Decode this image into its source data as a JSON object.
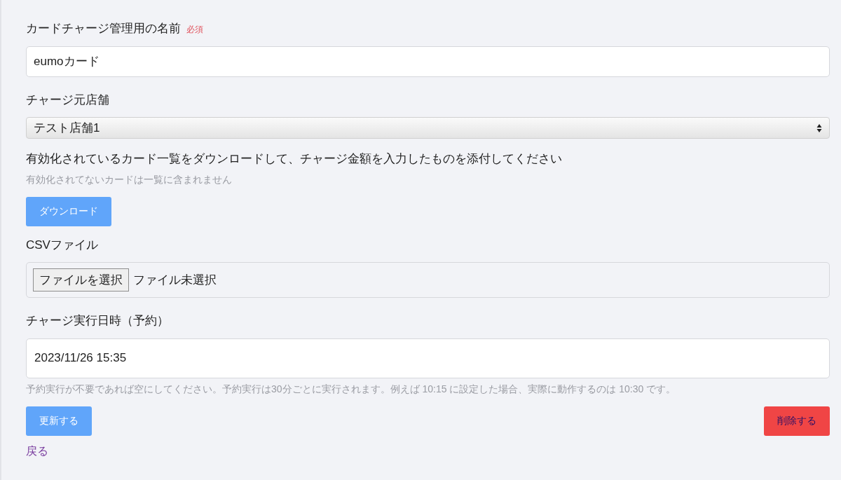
{
  "name_field": {
    "label": "カードチャージ管理用の名前",
    "required": "必須",
    "value": "eumoカード"
  },
  "store_field": {
    "label": "チャージ元店舗",
    "value": "テスト店舗1"
  },
  "download": {
    "instruction": "有効化されているカード一覧をダウンロードして、チャージ金額を入力したものを添付してください",
    "note": "有効化されてないカードは一覧に含まれません",
    "button": "ダウンロード"
  },
  "csv_field": {
    "label": "CSVファイル",
    "button": "ファイルを選択",
    "status": "ファイル未選択"
  },
  "schedule_field": {
    "label": "チャージ実行日時（予約）",
    "value": "2023/11/26 15:35",
    "help": "予約実行が不要であれば空にしてください。予約実行は30分ごとに実行されます。例えば 10:15 に設定した場合、実際に動作するのは 10:30 です。"
  },
  "actions": [
    {
      "label": "更新する",
      "kind": "primary"
    },
    {
      "label": "削除する",
      "kind": "danger"
    }
  ],
  "back_link": "戻る"
}
